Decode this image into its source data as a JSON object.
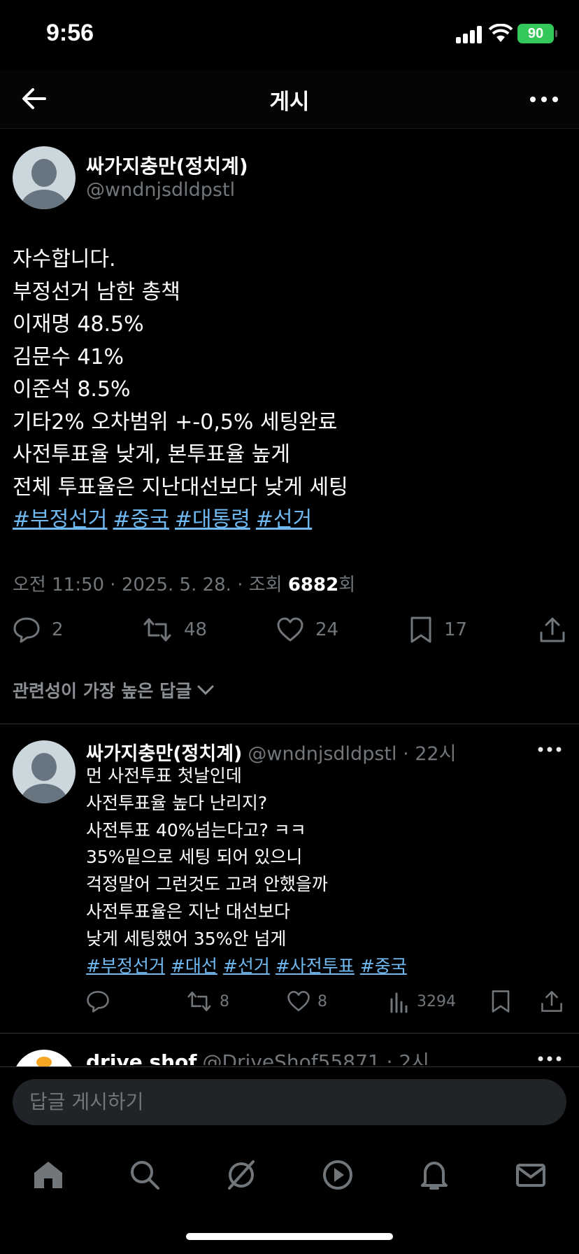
{
  "status_bar": {
    "time": "9:56",
    "battery": "90"
  },
  "header": {
    "title": "게시"
  },
  "post": {
    "author_name": "싸가지충만(정치계)",
    "author_handle": "@wndnjsdldpstl",
    "lines": [
      "자수합니다.",
      "부정선거 남한 총책",
      "이재명 48.5%",
      "김문수 41%",
      "이준석 8.5%",
      "기타2% 오차범위 +-0,5% 세팅완료",
      "사전투표율 낮게, 본투표율 높게",
      "전체 투표율은 지난대선보다 낮게 세팅"
    ],
    "hashtags": [
      "#부정선거",
      "#중국",
      "#대통령",
      "#선거"
    ],
    "meta_time": "오전 11:50 · 2025. 5. 28. · 조회 ",
    "meta_views": "6882",
    "meta_views_suffix": "회",
    "replies": "2",
    "reposts": "48",
    "likes": "24",
    "bookmarks": "17"
  },
  "sort_label": "관련성이 가장 높은 답글",
  "reply1": {
    "name": "싸가지충만(정치계)",
    "handle": "@wndnjsdldpstl · 22시",
    "lines": [
      "먼 사전투표 첫날인데",
      "사전투표율 높다 난리지?",
      "사전투표 40%넘는다고? ㅋㅋ",
      "35%밑으로 세팅 되어 있으니",
      "걱정말어 그런것도 고려 안했을까",
      "사전투표율은 지난 대선보다",
      "낮게 세팅했어 35%안 넘게"
    ],
    "hashtags": [
      "#부정선거",
      "#대선",
      "#선거",
      "#사전투표",
      "#중국"
    ],
    "reposts": "8",
    "likes": "8",
    "views": "3294"
  },
  "reply2": {
    "name": "drive shof",
    "handle": "@DriveShof55871 · 2시"
  },
  "composer": {
    "placeholder": "답글 게시하기"
  }
}
